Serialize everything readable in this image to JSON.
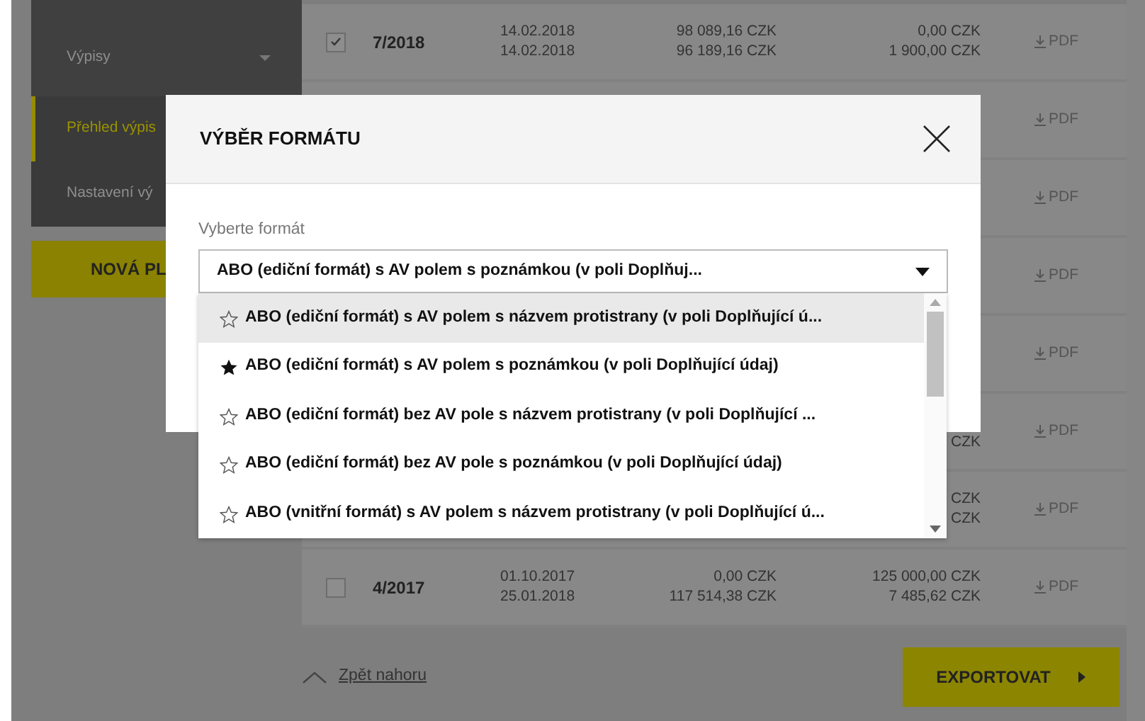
{
  "sidebar": {
    "items": [
      {
        "label": "Výpisy",
        "kind": "group",
        "selected": false
      },
      {
        "label": "Přehled výpis",
        "kind": "link",
        "selected": true
      },
      {
        "label": "Nastavení vý",
        "kind": "link",
        "selected": false
      }
    ],
    "button": "NOVÁ PL"
  },
  "statements": [
    {
      "checked": true,
      "period": "7/2018",
      "dates": [
        "14.02.2018",
        "14.02.2018"
      ],
      "amounts": [
        "98 089,16 CZK",
        "96 189,16 CZK"
      ],
      "balances": [
        "0,00 CZK",
        "1 900,00 CZK"
      ],
      "download": "PDF"
    },
    {
      "download": "PDF"
    },
    {
      "download": "PDF"
    },
    {
      "download": "PDF"
    },
    {
      "download": "PDF"
    },
    {
      "balances": [
        "CZK"
      ],
      "download": "PDF"
    },
    {
      "balances": [
        "CZK",
        "CZK"
      ],
      "download": "PDF"
    },
    {
      "checked": false,
      "period": "4/2017",
      "dates": [
        "01.10.2017",
        "25.01.2018"
      ],
      "amounts": [
        "0,00 CZK",
        "117 514,38 CZK"
      ],
      "balances": [
        "125 000,00 CZK",
        "7 485,62 CZK"
      ],
      "download": "PDF"
    }
  ],
  "back_to_top": "Zpět nahoru",
  "export_button": "EXPORTOVAT",
  "modal": {
    "title": "VÝBĚR FORMÁTU",
    "field_label": "Vyberte formát",
    "value": "ABO (ediční formát) s AV polem s poznámkou (v poli Doplňuj...",
    "options": [
      {
        "label": "ABO (ediční formát) s AV polem s názvem protistrany (v poli Doplňující ú...",
        "favorite": false,
        "highlighted": true
      },
      {
        "label": "ABO (ediční formát) s AV polem s poznámkou (v poli Doplňující údaj)",
        "favorite": true,
        "highlighted": false
      },
      {
        "label": "ABO (ediční formát) bez AV pole s názvem protistrany (v poli Doplňující ...",
        "favorite": false,
        "highlighted": false
      },
      {
        "label": "ABO (ediční formát) bez AV pole s poznámkou (v poli Doplňující údaj)",
        "favorite": false,
        "highlighted": false
      },
      {
        "label": "ABO (vnitřní formát) s AV polem s názvem protistrany (v poli Doplňující ú...",
        "favorite": false,
        "highlighted": false
      }
    ]
  }
}
